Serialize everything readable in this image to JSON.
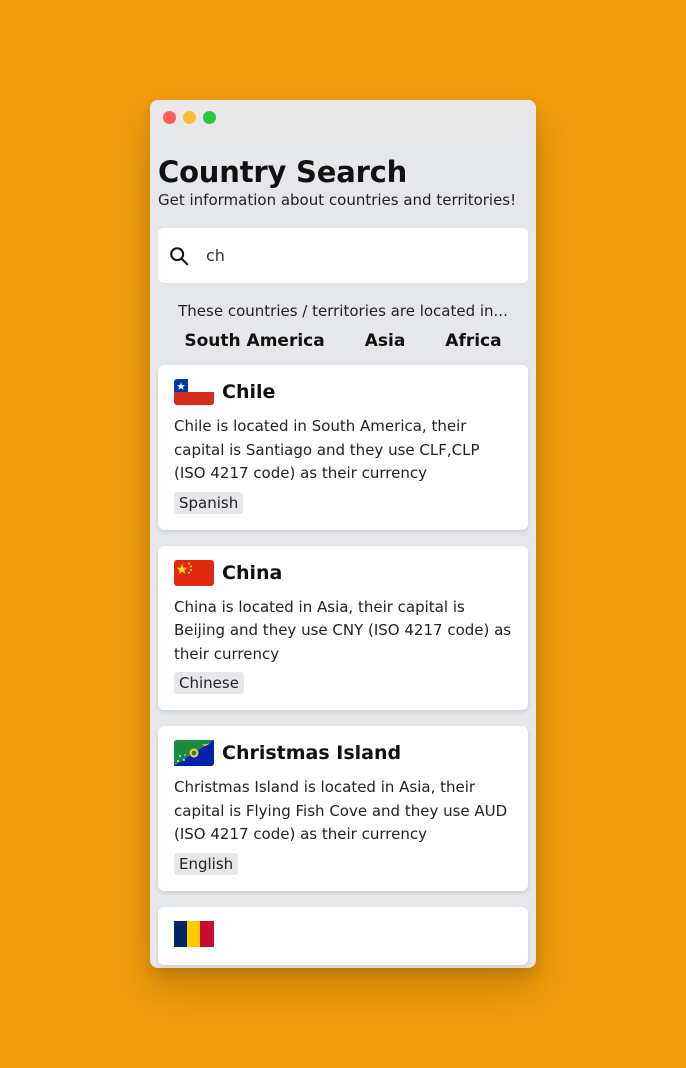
{
  "app": {
    "title": "Country Search",
    "subtitle": "Get information about countries and territories!"
  },
  "search": {
    "value": "ch",
    "placeholder": ""
  },
  "regions": {
    "intro": "These countries / territories are located in...",
    "items": [
      "South America",
      "Asia",
      "Africa"
    ]
  },
  "countries": [
    {
      "name": "Chile",
      "flag_icon": "flag-chile-icon",
      "description": "Chile is located in South America, their capital is Santiago and they use CLF,CLP (ISO 4217 code) as their currency",
      "language": "Spanish"
    },
    {
      "name": "China",
      "flag_icon": "flag-china-icon",
      "description": "China is located in Asia, their capital is Beijing and they use CNY (ISO 4217 code) as their currency",
      "language": "Chinese"
    },
    {
      "name": "Christmas Island",
      "flag_icon": "flag-christmas-island-icon",
      "description": "Christmas Island is located in Asia, their capital is Flying Fish Cove and they use AUD (ISO 4217 code) as their currency",
      "language": "English"
    }
  ],
  "colors": {
    "background": "#F39C0C",
    "window": "#E5E7EB",
    "card": "#FFFFFF",
    "badge": "#E5E7EB"
  }
}
